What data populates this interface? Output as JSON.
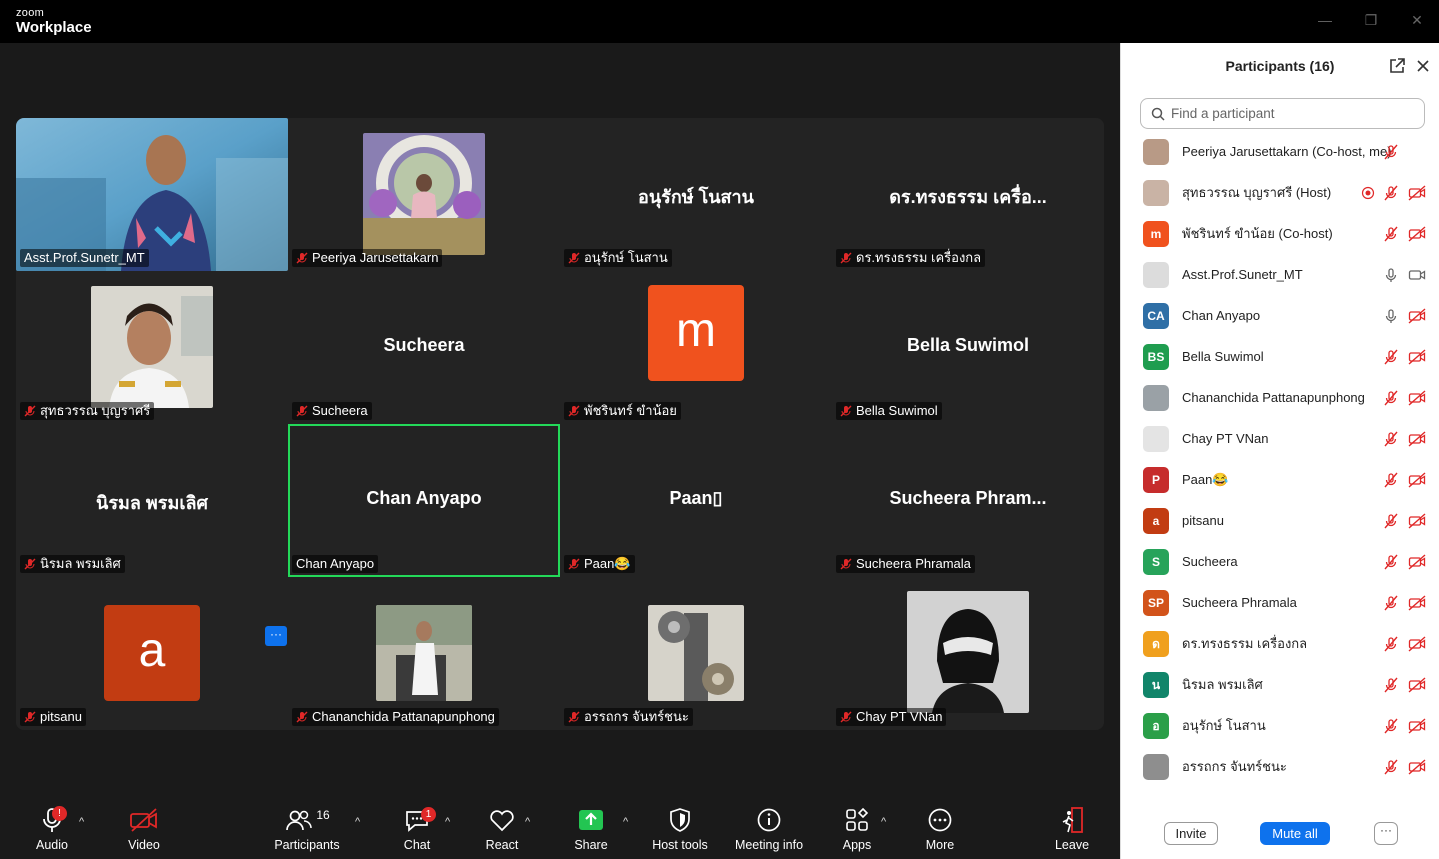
{
  "titlebar": {
    "brand_small": "zoom",
    "brand_big": "Workplace",
    "minimize": "—",
    "maximize": "❐",
    "close": "✕"
  },
  "tiles": [
    {
      "bigname": "",
      "label": "Asst.Prof.Sunetr_MT",
      "muted": false,
      "kind": "video"
    },
    {
      "bigname": "",
      "label": "Peeriya Jarusettakarn",
      "muted": true,
      "kind": "photo"
    },
    {
      "bigname": "อนุรักษ์ โนสาน",
      "label": "อนุรักษ์ โนสาน",
      "muted": true,
      "kind": "name"
    },
    {
      "bigname": "ดร.ทรงธรรม เครื่อ...",
      "label": "ดร.ทรงธรรม เครื่องกล",
      "muted": true,
      "kind": "name"
    },
    {
      "bigname": "",
      "label": "สุทธวรรณ บุญราศรี",
      "muted": true,
      "kind": "photo"
    },
    {
      "bigname": "Sucheera",
      "label": "Sucheera",
      "muted": true,
      "kind": "name"
    },
    {
      "bigname": "m",
      "label": "พัชรินทร์ ขำน้อย",
      "muted": true,
      "kind": "letter"
    },
    {
      "bigname": "Bella Suwimol",
      "label": "Bella Suwimol",
      "muted": true,
      "kind": "name"
    },
    {
      "bigname": "นิรมล พรมเลิศ",
      "label": "นิรมล พรมเลิศ",
      "muted": true,
      "kind": "name"
    },
    {
      "bigname": "Chan Anyapo",
      "label": "Chan Anyapo",
      "muted": false,
      "kind": "name"
    },
    {
      "bigname": "Paan▯",
      "label": "Paan😂",
      "muted": true,
      "kind": "name"
    },
    {
      "bigname": "Sucheera  Phram...",
      "label": "Sucheera Phramala",
      "muted": true,
      "kind": "name"
    },
    {
      "bigname": "a",
      "label": "pitsanu",
      "muted": true,
      "kind": "letter"
    },
    {
      "bigname": "",
      "label": "Chananchida Pattanapunphong",
      "muted": true,
      "kind": "photo"
    },
    {
      "bigname": "",
      "label": "อรรถกร จันทร์ชนะ",
      "muted": true,
      "kind": "photo"
    },
    {
      "bigname": "",
      "label": "Chay PT VNan",
      "muted": true,
      "kind": "photo"
    }
  ],
  "tile_more": "···",
  "toolbar": {
    "audio": "Audio",
    "audio_badge": "!",
    "video": "Video",
    "participants": "Participants",
    "participants_count": "16",
    "chat": "Chat",
    "chat_badge": "1",
    "react": "React",
    "share": "Share",
    "host_tools": "Host tools",
    "meeting_info": "Meeting info",
    "apps": "Apps",
    "more": "More",
    "leave": "Leave",
    "caret": "^"
  },
  "panel": {
    "title": "Participants (16)",
    "search_placeholder": "Find a participant",
    "invite": "Invite",
    "mute_all": "Mute all",
    "more": "···",
    "participants": [
      {
        "name": "Peeriya Jarusettakarn (Co-host, me)",
        "avatar": "",
        "color": "#b89a86",
        "mic": "off",
        "cam": "none",
        "rec": false
      },
      {
        "name": "สุทธวรรณ บุญราศรี (Host)",
        "avatar": "",
        "color": "#c9b3a5",
        "mic": "off",
        "cam": "off",
        "rec": true
      },
      {
        "name": "พัชรินทร์ ขำน้อย (Co-host)",
        "avatar": "m",
        "color": "#f0521e",
        "mic": "off",
        "cam": "off",
        "rec": false
      },
      {
        "name": "Asst.Prof.Sunetr_MT",
        "avatar": "",
        "color": "#dcdcdc",
        "mic": "on",
        "cam": "on",
        "rec": false
      },
      {
        "name": "Chan Anyapo",
        "avatar": "CA",
        "color": "#2f6fa6",
        "mic": "on",
        "cam": "off",
        "rec": false
      },
      {
        "name": "Bella Suwimol",
        "avatar": "BS",
        "color": "#1f9d4f",
        "mic": "off",
        "cam": "off",
        "rec": false
      },
      {
        "name": "Chananchida Pattanapunphong",
        "avatar": "",
        "color": "#9aa1a6",
        "mic": "off",
        "cam": "off",
        "rec": false
      },
      {
        "name": "Chay PT VNan",
        "avatar": "",
        "color": "#e4e4e4",
        "mic": "off",
        "cam": "off",
        "rec": false
      },
      {
        "name": "Paan😂",
        "avatar": "P",
        "color": "#c62c2c",
        "mic": "off",
        "cam": "off",
        "rec": false
      },
      {
        "name": "pitsanu",
        "avatar": "a",
        "color": "#c23c12",
        "mic": "off",
        "cam": "off",
        "rec": false
      },
      {
        "name": "Sucheera",
        "avatar": "S",
        "color": "#27a35a",
        "mic": "off",
        "cam": "off",
        "rec": false
      },
      {
        "name": "Sucheera Phramala",
        "avatar": "SP",
        "color": "#d2531a",
        "mic": "off",
        "cam": "off",
        "rec": false
      },
      {
        "name": "ดร.ทรงธรรม เครื่องกล",
        "avatar": "ด",
        "color": "#f0a01e",
        "mic": "off",
        "cam": "off",
        "rec": false
      },
      {
        "name": "นิรมล พรมเลิศ",
        "avatar": "น",
        "color": "#11856a",
        "mic": "off",
        "cam": "off",
        "rec": false
      },
      {
        "name": "อนุรักษ์ โนสาน",
        "avatar": "อ",
        "color": "#2b9f49",
        "mic": "off",
        "cam": "off",
        "rec": false
      },
      {
        "name": "อรรถกร จันทร์ชนะ",
        "avatar": "",
        "color": "#8e8e8e",
        "mic": "off",
        "cam": "off",
        "rec": false
      }
    ]
  }
}
